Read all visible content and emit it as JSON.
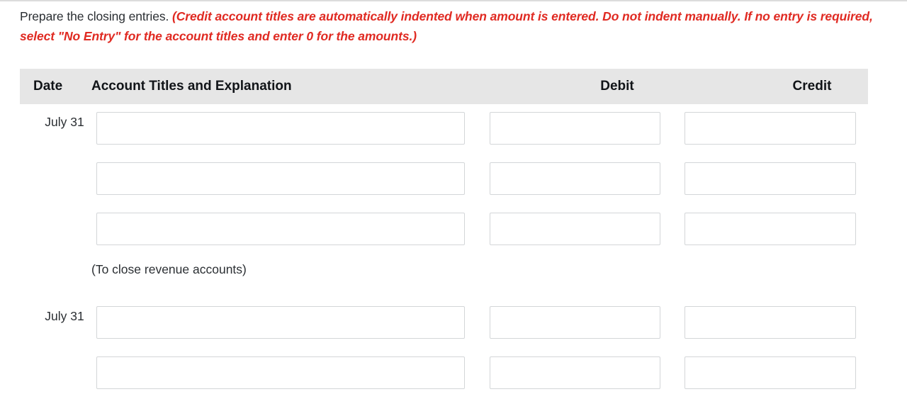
{
  "instructions": {
    "lead": "Prepare the closing entries.",
    "note": "(Credit account titles are automatically indented when amount is entered. Do not indent manually. If no entry is required, select \"No Entry\" for the account titles and enter 0 for the amounts.)"
  },
  "table": {
    "headers": {
      "date": "Date",
      "account": "Account Titles and Explanation",
      "debit": "Debit",
      "credit": "Credit"
    },
    "placeholders": {
      "account": "",
      "debit": "",
      "credit": ""
    },
    "rows": [
      {
        "type": "entry",
        "date": "July 31",
        "account_value": "",
        "debit_value": "",
        "credit_value": ""
      },
      {
        "type": "entry",
        "date": "",
        "account_value": "",
        "debit_value": "",
        "credit_value": ""
      },
      {
        "type": "entry",
        "date": "",
        "account_value": "",
        "debit_value": "",
        "credit_value": ""
      },
      {
        "type": "caption",
        "caption": "(To close revenue accounts)"
      },
      {
        "type": "entry",
        "date": "July 31",
        "account_value": "",
        "debit_value": "",
        "credit_value": ""
      },
      {
        "type": "entry",
        "date": "",
        "account_value": "",
        "debit_value": "",
        "credit_value": ""
      }
    ]
  },
  "colors": {
    "note_red": "#e02a22",
    "header_bg": "#e6e6e6",
    "text": "#2b2f33",
    "field_border": "#d3d6d8"
  }
}
